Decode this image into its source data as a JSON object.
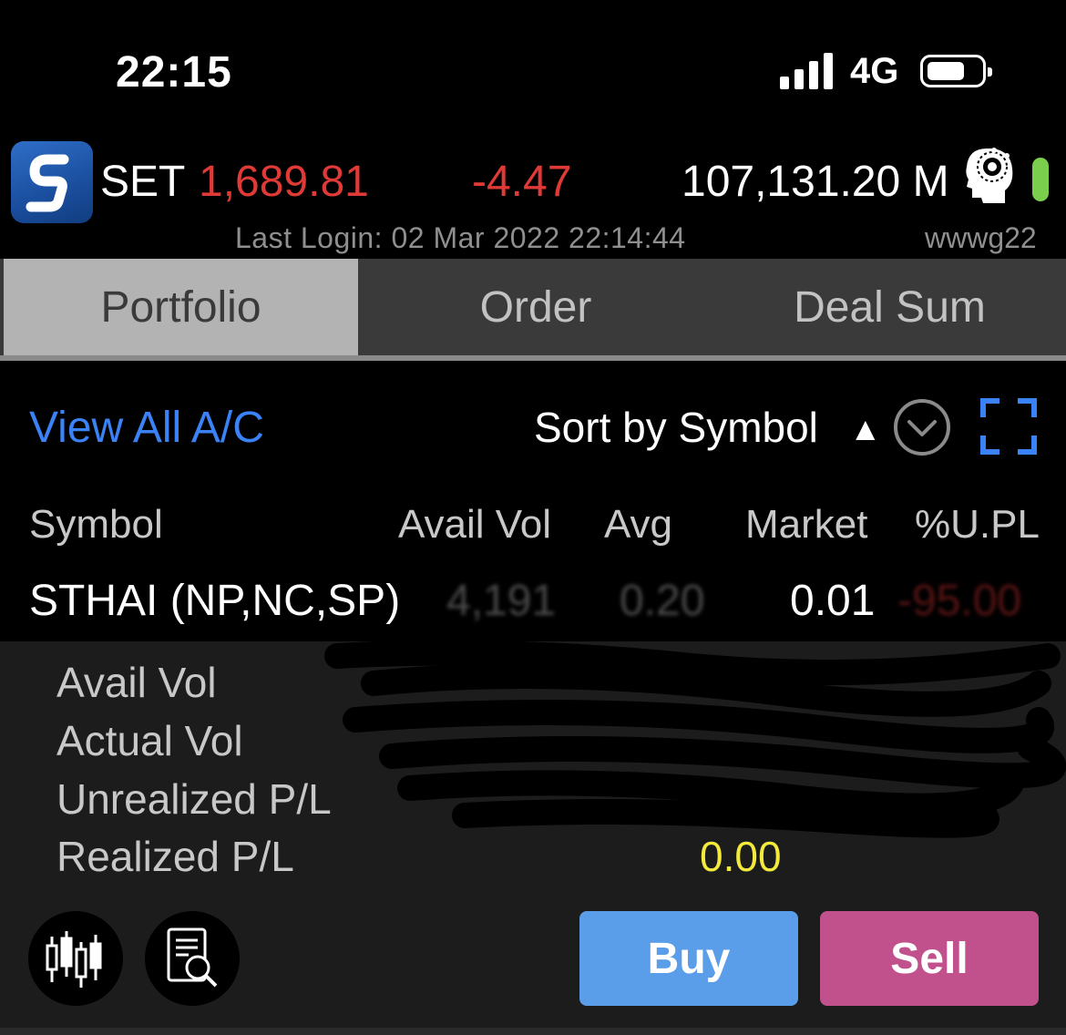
{
  "status_bar": {
    "time": "22:15",
    "network": "4G",
    "signal_bars": 4,
    "battery_level": 0.6
  },
  "market": {
    "index_name": "SET",
    "index_value": "1,689.81",
    "index_change": "-4.47",
    "volume": "107,131.20 M",
    "last_login": "Last Login: 02 Mar 2022 22:14:44",
    "username": "wwwg22",
    "down_color": "#e03a37",
    "status_color": "#7acf4c"
  },
  "tabs": [
    {
      "label": "Portfolio",
      "active": true
    },
    {
      "label": "Order",
      "active": false
    },
    {
      "label": "Deal Sum",
      "active": false
    }
  ],
  "toolbar": {
    "view_all": "View All A/C",
    "sort_label": "Sort by Symbol",
    "sort_direction": "▲",
    "link_color": "#3b82f6"
  },
  "table": {
    "headers": [
      "Symbol",
      "Avail Vol",
      "Avg",
      "Market",
      "%U.PL"
    ],
    "row": {
      "symbol": "STHAI (NP,NC,SP)",
      "avail_vol": "4,191",
      "avg": "0.20",
      "market": "0.01",
      "upl_pct": "-95.00"
    }
  },
  "detail": {
    "labels": [
      "Avail Vol",
      "Actual Vol",
      "Unrealized P/L",
      "Realized P/L"
    ],
    "realized_value": "0.00",
    "realized_color": "#f3ea3c"
  },
  "actions": {
    "buy": "Buy",
    "sell": "Sell",
    "buy_color": "#5a9de8",
    "sell_color": "#c0518c",
    "icons": [
      "candlestick-chart-icon",
      "document-search-icon"
    ]
  }
}
